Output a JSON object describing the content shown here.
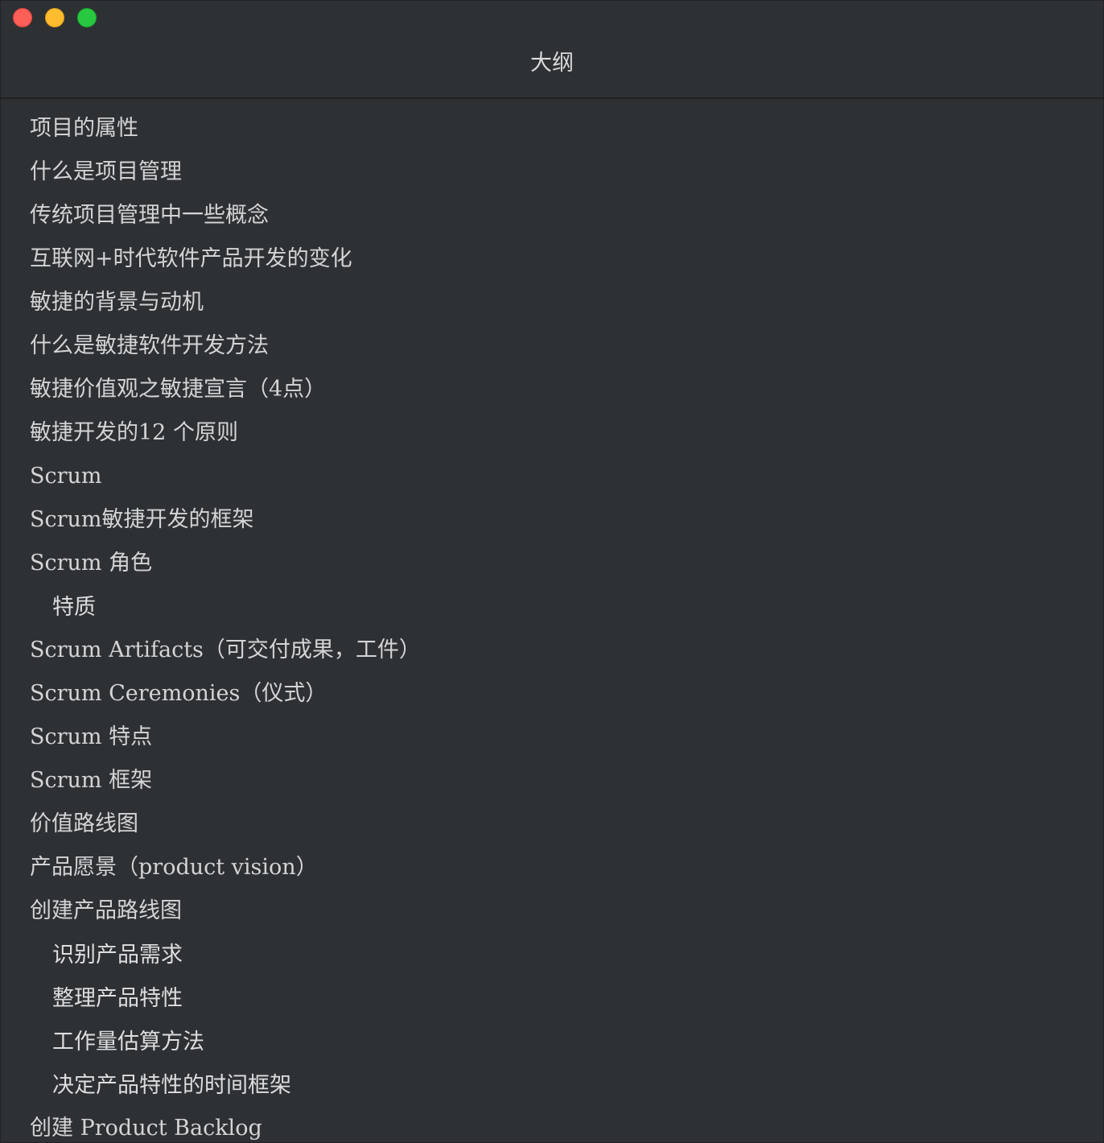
{
  "window": {
    "title": "大纲"
  },
  "outline": {
    "items": [
      {
        "label": "项目的属性",
        "level": 1
      },
      {
        "label": "什么是项目管理",
        "level": 1
      },
      {
        "label": "传统项目管理中一些概念",
        "level": 1
      },
      {
        "label": "互联网+时代软件产品开发的变化",
        "level": 1
      },
      {
        "label": "敏捷的背景与动机",
        "level": 1
      },
      {
        "label": "什么是敏捷软件开发方法",
        "level": 1
      },
      {
        "label": "敏捷价值观之敏捷宣言（4点）",
        "level": 1
      },
      {
        "label": "敏捷开发的12 个原则",
        "level": 1
      },
      {
        "label": "Scrum",
        "level": 1
      },
      {
        "label": "Scrum敏捷开发的框架",
        "level": 1
      },
      {
        "label": "Scrum 角色",
        "level": 1
      },
      {
        "label": "特质",
        "level": 2
      },
      {
        "label": "Scrum Artifacts（可交付成果，工件）",
        "level": 1
      },
      {
        "label": "Scrum Ceremonies（仪式）",
        "level": 1
      },
      {
        "label": "Scrum 特点",
        "level": 1
      },
      {
        "label": "Scrum 框架",
        "level": 1
      },
      {
        "label": "价值路线图",
        "level": 1
      },
      {
        "label": "产品愿景（product vision）",
        "level": 1
      },
      {
        "label": "创建产品路线图",
        "level": 1
      },
      {
        "label": "识别产品需求",
        "level": 2
      },
      {
        "label": "整理产品特性",
        "level": 2
      },
      {
        "label": "工作量估算方法",
        "level": 2
      },
      {
        "label": "决定产品特性的时间框架",
        "level": 2
      },
      {
        "label": "创建 Product Backlog",
        "level": 1
      }
    ]
  },
  "colors": {
    "background": "#2e3134",
    "text": "#d2d4d6",
    "close": "#fe5f57",
    "minimize": "#febc2e",
    "maximize": "#28c840"
  }
}
